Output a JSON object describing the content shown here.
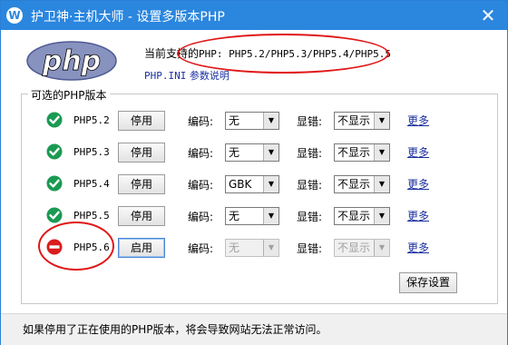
{
  "window": {
    "title": "护卫神·主机大师 - 设置多版本PHP",
    "app_icon": "W",
    "close_glyph": "✕"
  },
  "logo": {
    "text": "php"
  },
  "supported": {
    "label": "当前支持的",
    "list": "PHP: PHP5.2/PHP5.3/PHP5.4/PHP5.5"
  },
  "phpini_link": {
    "mono": "PHP.INI",
    "text": " 参数说明"
  },
  "group": {
    "legend": "可选的PHP版本"
  },
  "labels": {
    "encoding": "编码:",
    "error_display": "显错:",
    "more": "更多"
  },
  "rows": [
    {
      "version": "PHP5.2",
      "status": "enabled",
      "button": "停用",
      "encoding": "无",
      "error": "不显示",
      "disabled": false
    },
    {
      "version": "PHP5.3",
      "status": "enabled",
      "button": "停用",
      "encoding": "无",
      "error": "不显示",
      "disabled": false
    },
    {
      "version": "PHP5.4",
      "status": "enabled",
      "button": "停用",
      "encoding": "GBK",
      "error": "不显示",
      "disabled": false
    },
    {
      "version": "PHP5.5",
      "status": "enabled",
      "button": "停用",
      "encoding": "无",
      "error": "不显示",
      "disabled": false
    },
    {
      "version": "PHP5.6",
      "status": "disabled",
      "button": "启用",
      "encoding": "无",
      "error": "不显示",
      "disabled": true
    }
  ],
  "save_button": "保存设置",
  "footer": {
    "note": "如果停用了正在使用的PHP版本，将会导致网站无法正常访问。"
  },
  "colors": {
    "titlebar": "#2b86de",
    "enabled": "#1a9a52",
    "disabled": "#d91c1c",
    "annotation": "#e01818",
    "link": "#1a2fa0"
  },
  "icons": {
    "enabled": "check-circle-icon",
    "disabled": "no-entry-icon"
  }
}
